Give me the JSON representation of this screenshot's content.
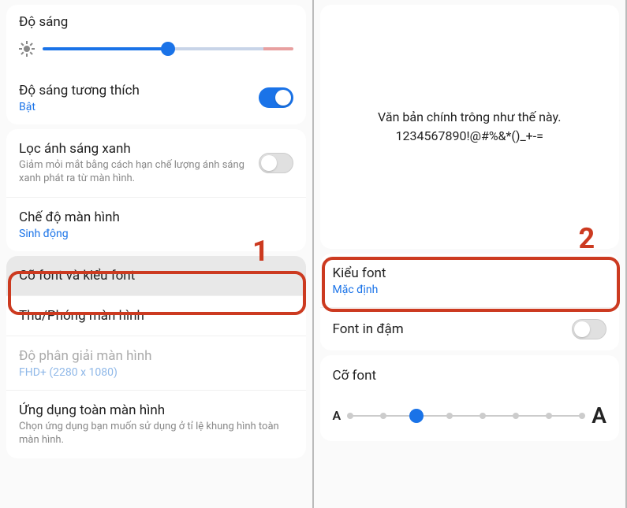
{
  "left": {
    "brightness": {
      "title": "Độ sáng",
      "value_pct": 50
    },
    "adaptive": {
      "title": "Độ sáng tương thích",
      "status": "Bật",
      "on": true
    },
    "bluefilter": {
      "title": "Lọc ánh sáng xanh",
      "desc": "Giảm mỏi mắt bằng cách hạn chế lượng ánh sáng xanh phát ra từ màn hình.",
      "on": false
    },
    "screenmode": {
      "title": "Chế độ màn hình",
      "value": "Sinh động"
    },
    "fontsize_style": {
      "title": "Cỡ font và kiểu font"
    },
    "zoom": {
      "title": "Thu/Phóng màn hình"
    },
    "resolution": {
      "title": "Độ phân giải màn hình",
      "value": "FHD+ (2280 x 1080)"
    },
    "fullscreen": {
      "title": "Ứng dụng toàn màn hình",
      "desc": "Chọn ứng dụng bạn muốn sử dụng ở tỉ lệ khung hình toàn màn hình."
    },
    "annotation": "1"
  },
  "right": {
    "preview": {
      "line1": "Văn bản chính trông như thế này.",
      "line2": "1234567890!@#%&*()_+-="
    },
    "fontstyle": {
      "title": "Kiểu font",
      "value": "Mặc định"
    },
    "boldfont": {
      "title": "Font in đậm",
      "on": false
    },
    "fontsize": {
      "title": "Cỡ font",
      "small_label": "A",
      "large_label": "A",
      "steps": 8,
      "value_index": 2
    },
    "annotation": "2"
  }
}
